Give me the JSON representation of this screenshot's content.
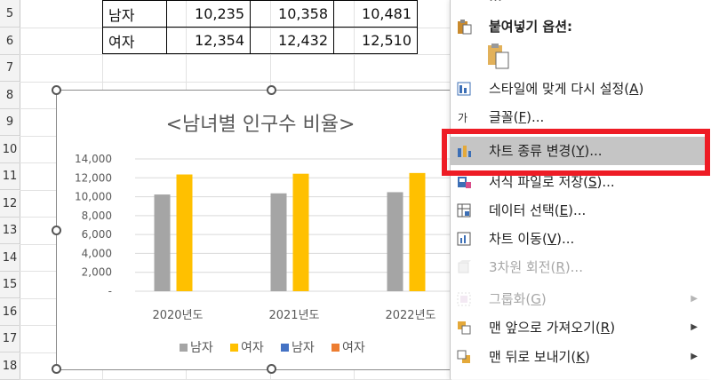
{
  "row_headers": [
    "5",
    "6",
    "7",
    "8",
    "9",
    "10",
    "11",
    "12",
    "13",
    "14",
    "15",
    "16",
    "17",
    "18"
  ],
  "table": {
    "rows": [
      {
        "label": "남자",
        "values": [
          "10,235",
          "10,358",
          "10,481"
        ]
      },
      {
        "label": "여자",
        "values": [
          "12,354",
          "12,432",
          "12,510"
        ]
      }
    ]
  },
  "chart_data": {
    "type": "bar",
    "title": "<남녀별 인구수 비율>",
    "categories": [
      "2020년도",
      "2021년도",
      "2022년도"
    ],
    "series": [
      {
        "name": "남자",
        "values": [
          10235,
          10358,
          10481
        ],
        "color": "#a5a5a5"
      },
      {
        "name": "여자",
        "values": [
          12354,
          12432,
          12510
        ],
        "color": "#ffc000"
      }
    ],
    "legend": [
      {
        "name": "남자",
        "color": "#a5a5a5"
      },
      {
        "name": "여자",
        "color": "#ffc000"
      },
      {
        "name": "남자",
        "color": "#4472c4"
      },
      {
        "name": "여자",
        "color": "#ed7d31"
      }
    ],
    "yticks": [
      "-",
      "2,000",
      "4,000",
      "6,000",
      "8,000",
      "10,000",
      "12,000",
      "14,000"
    ],
    "ylim": [
      0,
      14000
    ],
    "legend_position": "bottom",
    "grid": true
  },
  "menu": {
    "top_partial": "…",
    "paste_header": "붙여넣기 옵션:",
    "items": [
      {
        "icon": "reset-style-icon",
        "label": "스타일에 맞게 다시 설정(",
        "key": "A",
        "suffix": ")",
        "disabled": false,
        "highlighted": false,
        "submenu": false
      },
      {
        "icon": "font-icon",
        "label": "글꼴(",
        "key": "F",
        "suffix": ")...",
        "disabled": false,
        "highlighted": false,
        "submenu": false
      },
      {
        "icon": "change-chart-type-icon",
        "label": "차트 종류 변경(",
        "key": "Y",
        "suffix": ")...",
        "disabled": false,
        "highlighted": true,
        "submenu": false
      },
      {
        "icon": "save-template-icon",
        "label": "서식 파일로 저장(",
        "key": "S",
        "suffix": ")...",
        "disabled": false,
        "highlighted": false,
        "submenu": false
      },
      {
        "icon": "select-data-icon",
        "label": "데이터 선택(",
        "key": "E",
        "suffix": ")...",
        "disabled": false,
        "highlighted": false,
        "submenu": false
      },
      {
        "icon": "move-chart-icon",
        "label": "차트 이동(",
        "key": "V",
        "suffix": ")...",
        "disabled": false,
        "highlighted": false,
        "submenu": false
      },
      {
        "icon": "3d-rotation-icon",
        "label": "3차원 회전(",
        "key": "R",
        "suffix": ")...",
        "disabled": true,
        "highlighted": false,
        "submenu": false
      },
      {
        "icon": "group-icon",
        "label": "그룹화(",
        "key": "G",
        "suffix": ")",
        "disabled": true,
        "highlighted": false,
        "submenu": true
      },
      {
        "icon": "bring-to-front-icon",
        "label": "맨 앞으로 가져오기(",
        "key": "R",
        "suffix": ")",
        "disabled": false,
        "highlighted": false,
        "submenu": true
      },
      {
        "icon": "send-to-back-icon",
        "label": "맨 뒤로 보내기(",
        "key": "K",
        "suffix": ")",
        "disabled": false,
        "highlighted": false,
        "submenu": true
      }
    ]
  }
}
